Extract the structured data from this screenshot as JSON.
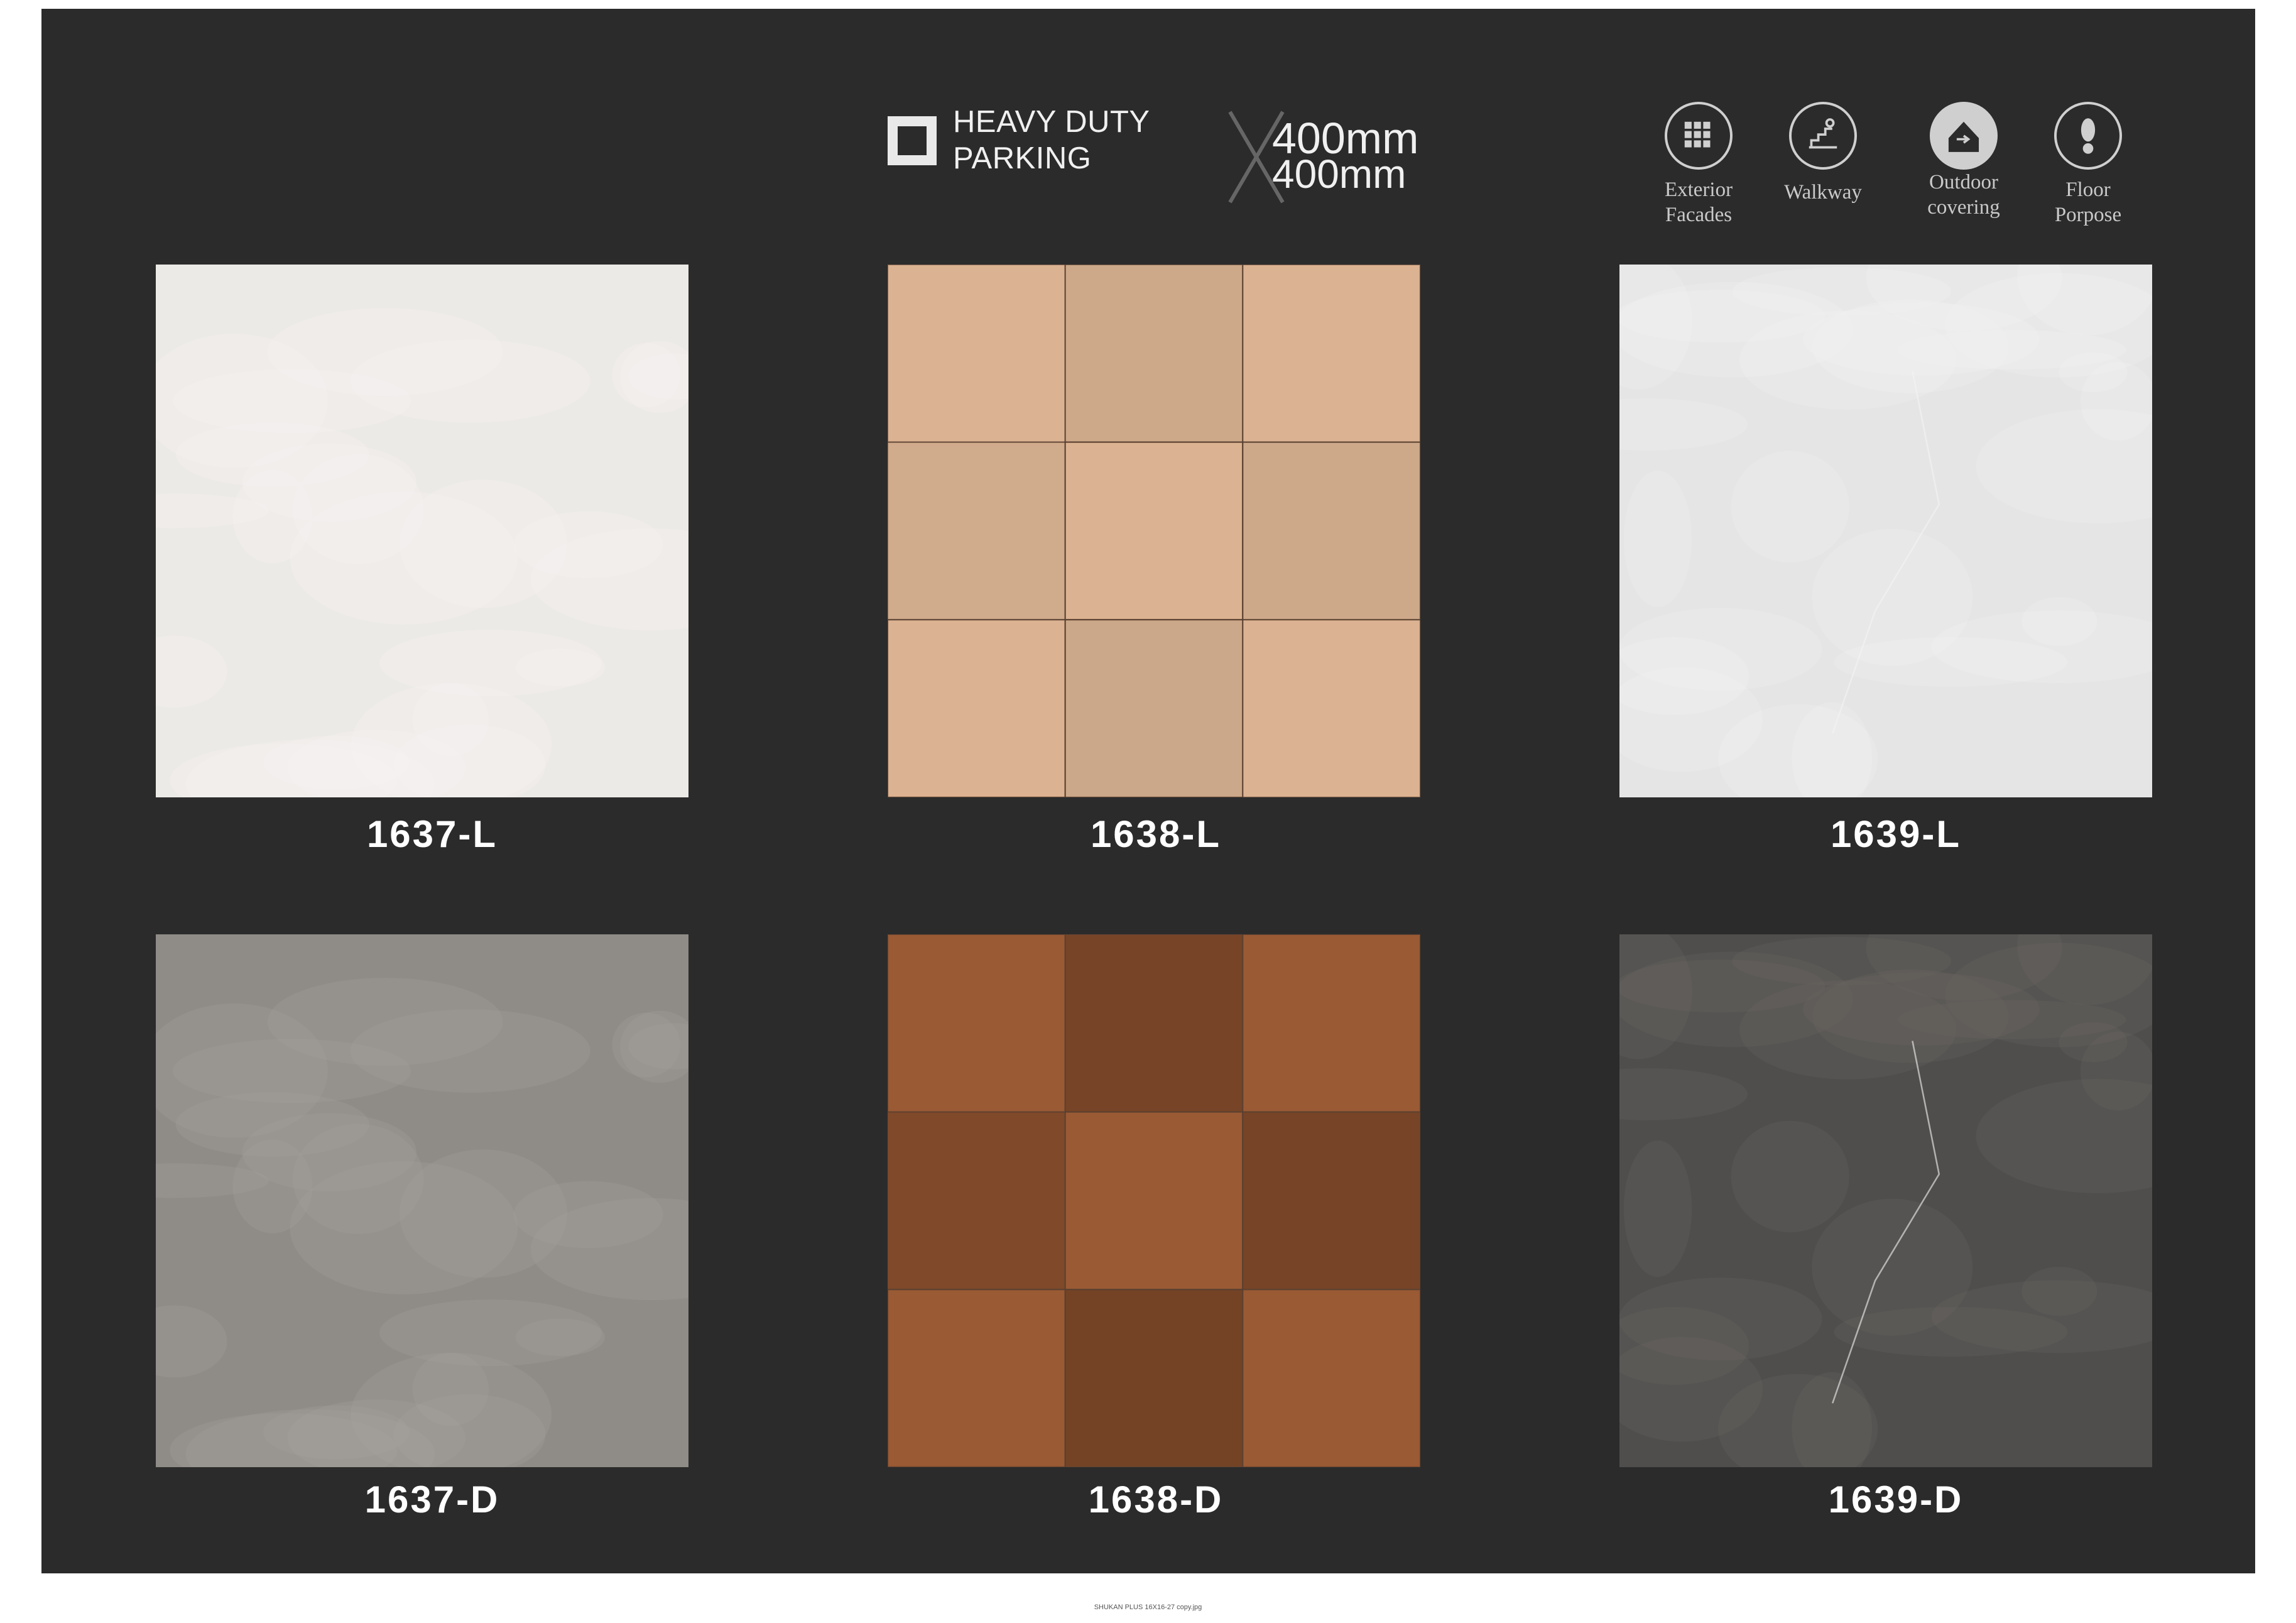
{
  "header": {
    "category_line1": "HEAVY DUTY",
    "category_line2": "PARKING",
    "size_line1": "400mm",
    "size_line2": "400mm"
  },
  "applications": [
    {
      "icon": "grid-icon",
      "line1": "Exterior",
      "line2": "Facades"
    },
    {
      "icon": "walkway-icon",
      "line1": "Walkway",
      "line2": ""
    },
    {
      "icon": "outdoor-icon",
      "line1": "Outdoor",
      "line2": "covering"
    },
    {
      "icon": "footprint-icon",
      "line1": "Floor",
      "line2": "Porpose"
    }
  ],
  "tiles": [
    {
      "code": "1637-L",
      "base": "#eceae7",
      "pattern": "marble",
      "tone2": "#f6f5f3"
    },
    {
      "code": "1638-L",
      "base": "#dcb392",
      "pattern": "grid",
      "tone2": "#c9a788"
    },
    {
      "code": "1639-L",
      "base": "#e4e5e4",
      "pattern": "stone",
      "tone2": "#f2f2f2"
    },
    {
      "code": "1637-D",
      "base": "#8f8b87",
      "pattern": "marble",
      "tone2": "#a7a39e"
    },
    {
      "code": "1638-D",
      "base": "#9a5a34",
      "pattern": "grid",
      "tone2": "#6e3f24"
    },
    {
      "code": "1639-D",
      "base": "#4f4e4c",
      "pattern": "stone",
      "tone2": "#6a6864"
    }
  ],
  "footer": "SHUKAN PLUS 16X16-27 copy.jpg"
}
